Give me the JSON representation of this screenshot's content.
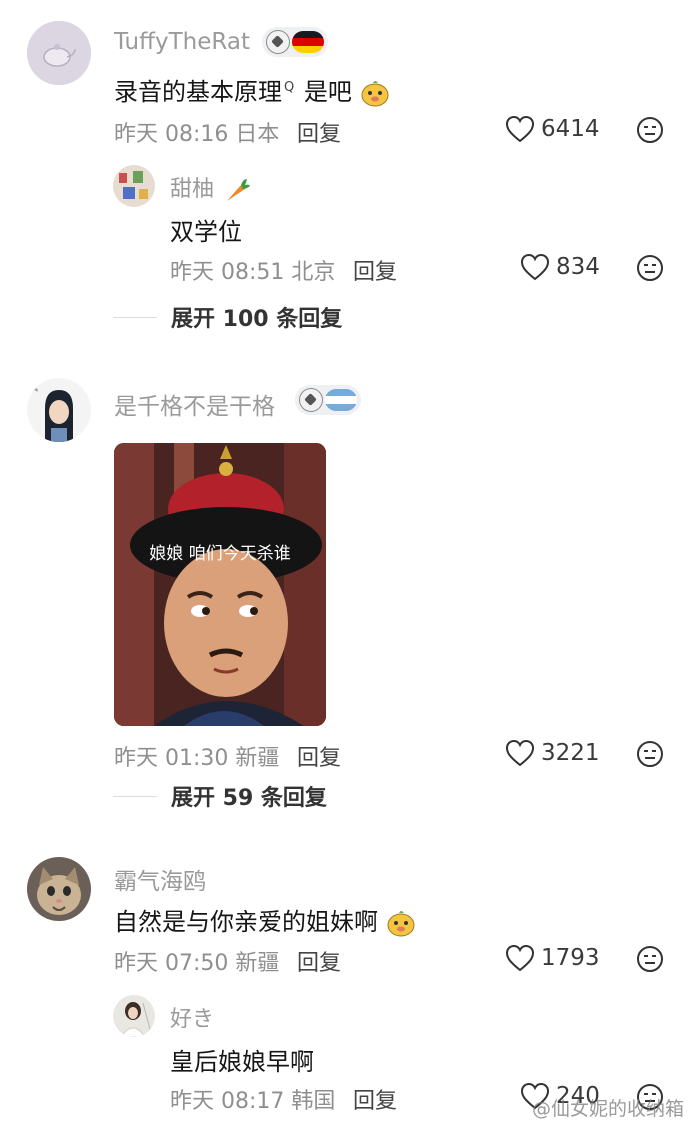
{
  "comments": [
    {
      "username": "TuffyTheRat",
      "text": "录音的基本原理",
      "search_mark": "Q",
      "text_suffix": "是吧",
      "time": "昨天 08:16 日本",
      "reply": "回复",
      "likes": "6414",
      "reply_thread": {
        "username": "甜柚",
        "text": "双学位",
        "time": "昨天 08:51 北京",
        "reply": "回复",
        "likes": "834"
      },
      "expand": "展开 100 条回复"
    },
    {
      "username": "是千格不是干格",
      "sticker_caption": "娘娘 咱们今天杀谁",
      "time": "昨天 01:30 新疆",
      "reply": "回复",
      "likes": "3221",
      "expand": "展开 59 条回复"
    },
    {
      "username": "霸气海鸥",
      "text": "自然是与你亲爱的姐妹啊",
      "time": "昨天 07:50 新疆",
      "reply": "回复",
      "likes": "1793",
      "reply_thread": {
        "username": "好き",
        "text": "皇后娘娘早啊",
        "time": "昨天 08:17 韩国",
        "reply": "回复",
        "likes": "240"
      }
    }
  ],
  "watermark": "@仙女妮的收纳箱",
  "colors": {
    "username": "#9a9a9a",
    "meta": "#8f8f8f",
    "text": "#161616"
  }
}
